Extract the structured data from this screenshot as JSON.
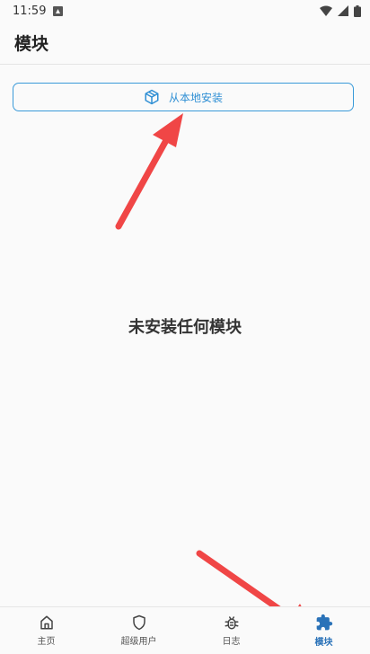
{
  "status_bar": {
    "time": "11:59"
  },
  "header": {
    "title": "模块"
  },
  "install": {
    "label": "从本地安装"
  },
  "empty_state": {
    "message": "未安装任何模块"
  },
  "bottom_nav": {
    "items": [
      {
        "label": "主页",
        "icon": "home-icon"
      },
      {
        "label": "超级用户",
        "icon": "shield-icon"
      },
      {
        "label": "日志",
        "icon": "bug-icon"
      },
      {
        "label": "模块",
        "icon": "puzzle-icon",
        "active": true
      }
    ]
  },
  "colors": {
    "accent": "#2f8fd4",
    "annotation_arrow": "#f04646"
  }
}
